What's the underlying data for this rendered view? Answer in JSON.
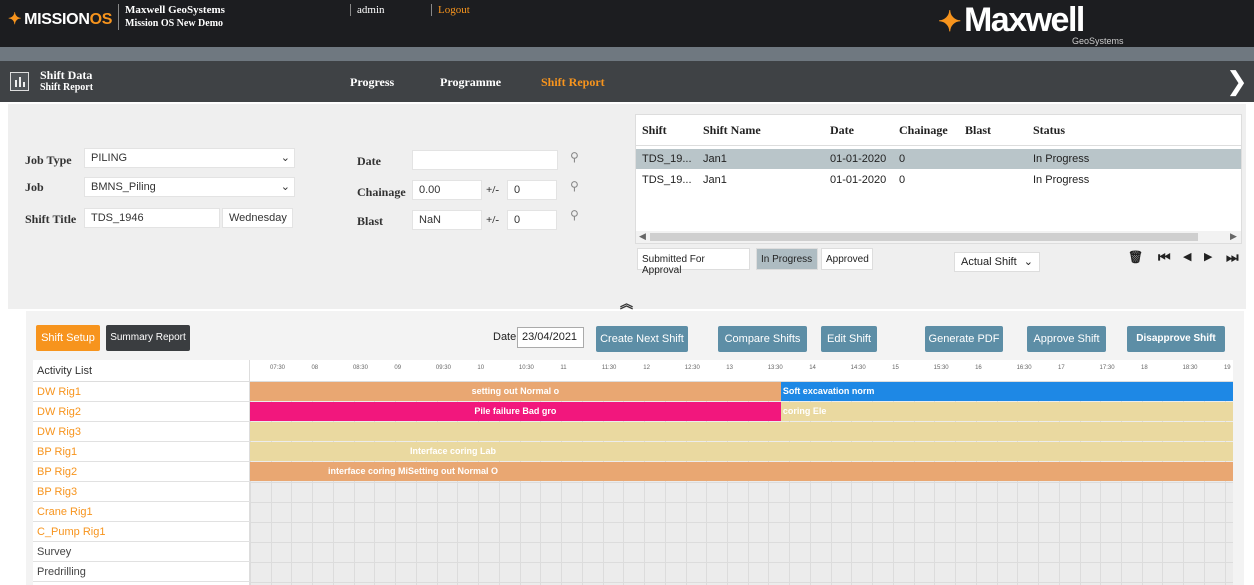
{
  "topbar": {
    "logo_prefix": "MISSION",
    "logo_suffix": "OS",
    "company": "Maxwell GeoSystems",
    "project": "Mission OS New Demo",
    "user": "admin",
    "logout": "Logout",
    "brand": "Maxwell",
    "brand_sub": "GeoSystems"
  },
  "navbar": {
    "title": "Shift Data",
    "subtitle": "Shift Report",
    "tabs": [
      "Progress",
      "Programme",
      "Shift Report"
    ],
    "active_tab": "Shift Report"
  },
  "form": {
    "job_type_label": "Job Type",
    "job_type_value": "PILING",
    "job_label": "Job",
    "job_value": "BMNS_Piling",
    "shift_title_label": "Shift Title",
    "shift_title_value": "TDS_1946",
    "shift_day": "Wednesday",
    "date_label": "Date",
    "date_value": "",
    "chainage_label": "Chainage",
    "chainage_value": "0.00",
    "chainage_pm_label": "+/-",
    "chainage_pm_value": "0",
    "blast_label": "Blast",
    "blast_value": "NaN",
    "blast_pm_label": "+/-",
    "blast_pm_value": "0"
  },
  "shift_table": {
    "headers": [
      "Shift",
      "Shift Name",
      "Date",
      "Chainage",
      "Blast",
      "Status"
    ],
    "rows": [
      {
        "shift": "TDS_19...",
        "name": "Jan1",
        "date": "01-01-2020",
        "chainage": "0",
        "blast": "",
        "status": "In Progress"
      },
      {
        "shift": "TDS_19...",
        "name": "Jan1",
        "date": "01-01-2020",
        "chainage": "0",
        "blast": "",
        "status": "In Progress"
      }
    ],
    "status_tabs": [
      "Submitted For Approval",
      "In Progress",
      "Approved"
    ],
    "active_status_tab": "In Progress",
    "filter_value": "Actual Shift"
  },
  "toolbar": {
    "shift_setup": "Shift Setup",
    "summary_report": "Summary Report",
    "date_label": "Date:",
    "date_value": "23/04/2021",
    "create_next_shift": "Create Next Shift",
    "compare_shifts": "Compare Shifts",
    "edit_shift": "Edit Shift",
    "generate_pdf": "Generate PDF",
    "approve_shift": "Approve Shift",
    "disapprove_shift": "Disapprove Shift"
  },
  "gantt": {
    "header": "Activity List",
    "ticks": [
      "07:30",
      "08",
      "08:30",
      "09",
      "09:30",
      "10",
      "10:30",
      "11",
      "11:30",
      "12",
      "12:30",
      "13",
      "13:30",
      "14",
      "14:30",
      "15",
      "15:30",
      "16",
      "16:30",
      "17",
      "17:30",
      "18",
      "18:30",
      "19"
    ],
    "activities": [
      {
        "name": "DW Rig1",
        "style": "orange"
      },
      {
        "name": "DW Rig2",
        "style": "orange"
      },
      {
        "name": "DW Rig3",
        "style": "orange"
      },
      {
        "name": "BP Rig1",
        "style": "orange"
      },
      {
        "name": "BP Rig2",
        "style": "orange"
      },
      {
        "name": "BP Rig3",
        "style": "orange"
      },
      {
        "name": "Crane Rig1",
        "style": "orange"
      },
      {
        "name": "C_Pump Rig1",
        "style": "orange"
      },
      {
        "name": "Survey",
        "style": "gray"
      },
      {
        "name": "Predrilling",
        "style": "gray"
      }
    ],
    "bars": [
      {
        "row": 0,
        "start": 0.0,
        "end": 0.54,
        "color": "#e9a772",
        "label": "setting out Normal o",
        "align": "center"
      },
      {
        "row": 0,
        "start": 0.54,
        "end": 1.0,
        "color": "#1e88e5",
        "label": "Soft excavation norm",
        "align": "left"
      },
      {
        "row": 1,
        "start": 0.0,
        "end": 0.54,
        "color": "#f2177d",
        "label": "Pile failure Bad gro",
        "align": "center"
      },
      {
        "row": 1,
        "start": 0.54,
        "end": 1.0,
        "color": "#ead9a0",
        "label": "coring Ele",
        "align": "left"
      },
      {
        "row": 2,
        "start": 0.0,
        "end": 1.0,
        "color": "#ead9a0",
        "label": "",
        "align": "center"
      },
      {
        "row": 3,
        "start": 0.0,
        "end": 1.0,
        "color": "#ead9a0",
        "label": "Interface coring Lab",
        "align": "left-offset"
      },
      {
        "row": 4,
        "start": 0.0,
        "end": 1.0,
        "color": "#e9a772",
        "label": "interface coring MiSetting out Normal O",
        "align": "left-offset2"
      }
    ]
  }
}
